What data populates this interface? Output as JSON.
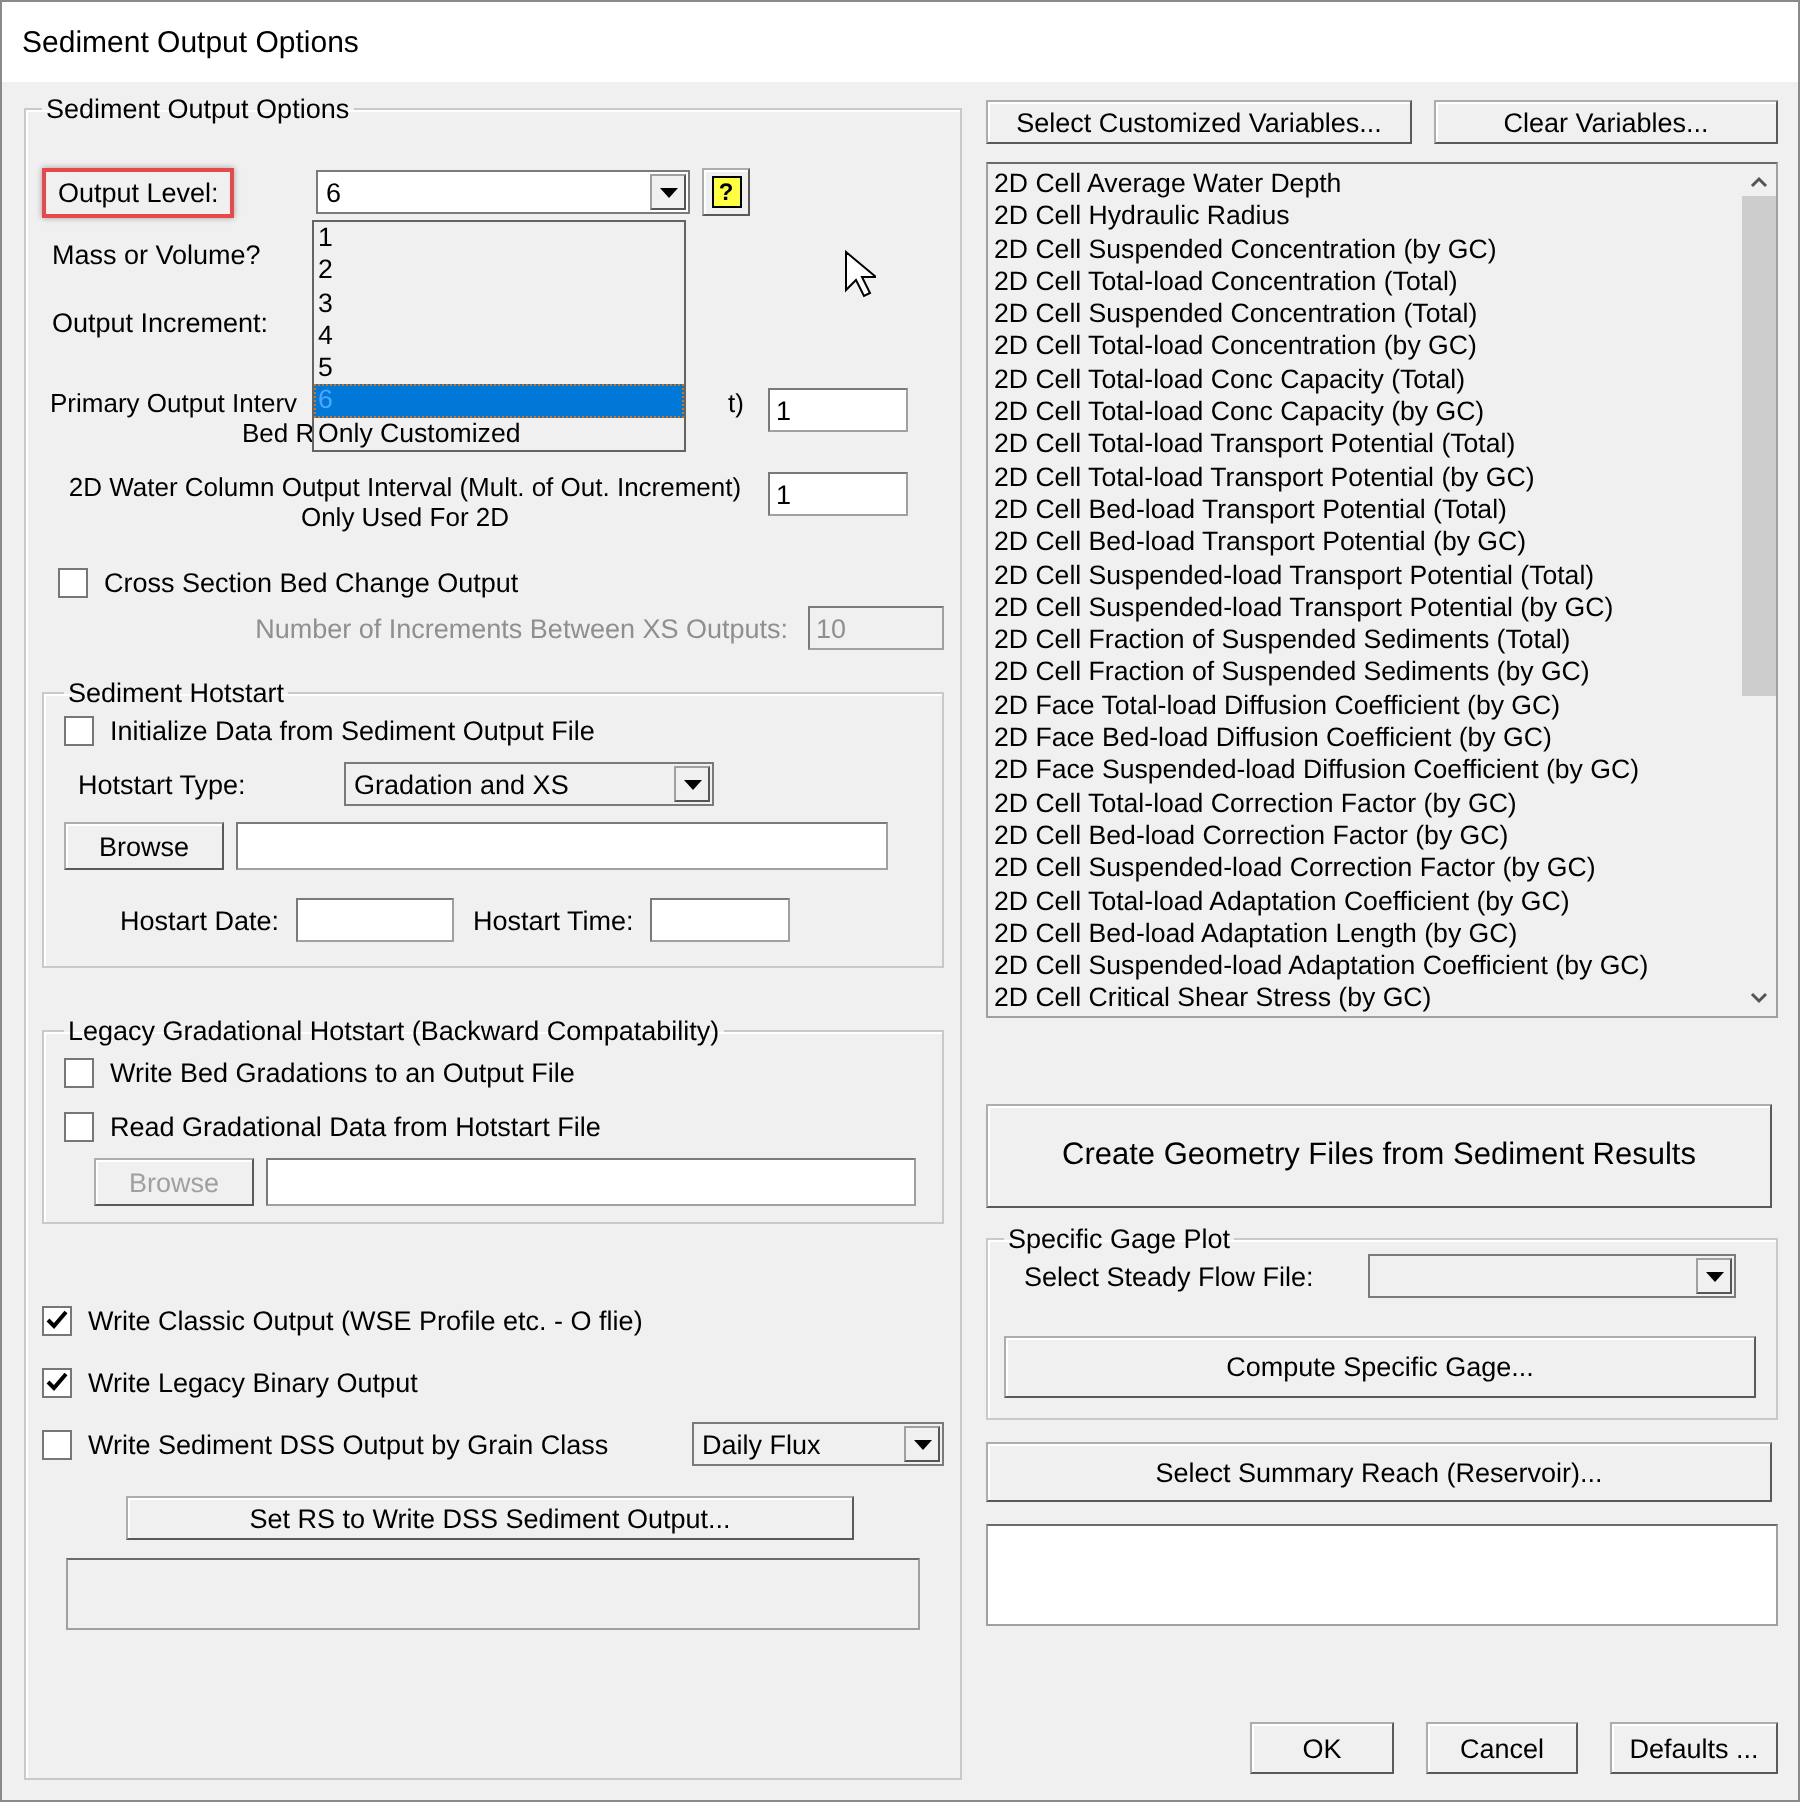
{
  "window": {
    "title": "Sediment Output Options"
  },
  "output_options": {
    "legend": "Sediment Output Options",
    "output_level": {
      "label": "Output Level:",
      "highlighted": true,
      "value": "6",
      "help_button": "?",
      "expanded": true,
      "options": [
        {
          "label": "1",
          "selected": false
        },
        {
          "label": "2",
          "selected": false
        },
        {
          "label": "3",
          "selected": false
        },
        {
          "label": "4",
          "selected": false
        },
        {
          "label": "5",
          "selected": false
        },
        {
          "label": "6",
          "selected": true
        },
        {
          "label": "Only Customized",
          "selected": false
        }
      ]
    },
    "mass_or_volume": {
      "label": "Mass or Volume?"
    },
    "output_increment": {
      "label": "Output Increment:"
    },
    "primary_interval": {
      "label_start": "Primary Output Interv",
      "label_end": "t)",
      "label_second_line": "Bed R",
      "value": "1"
    },
    "water_column_interval": {
      "label": "2D Water Column Output Interval (Mult. of Out. Increment)",
      "note": "Only Used For 2D",
      "value": "1"
    },
    "cross_section": {
      "label": "Cross Section Bed Change Output",
      "checked": false
    },
    "xs_increments": {
      "label": "Number of Increments Between XS Outputs:",
      "value": "10",
      "disabled": true
    },
    "hotstart": {
      "legend": "Sediment Hotstart",
      "initialize": {
        "label": "Initialize Data from Sediment Output File",
        "checked": false
      },
      "type_label": "Hotstart Type:",
      "type_value": "Gradation and XS",
      "browse": {
        "label": "Browse",
        "disabled": false
      },
      "date_label": "Hostart Date:",
      "time_label": "Hostart Time:"
    },
    "legacy": {
      "legend": "Legacy Gradational Hotstart (Backward Compatability)",
      "checkboxes": [
        {
          "label": "Write Bed Gradations to an Output File",
          "checked": false
        },
        {
          "label": "Read Gradational Data from Hotstart File",
          "checked": false
        }
      ],
      "browse": {
        "label": "Browse",
        "disabled": true
      }
    },
    "outputs": [
      {
        "label": "Write Classic Output (WSE Profile etc. - O flie)",
        "checked": true
      },
      {
        "label": "Write Legacy Binary Output",
        "checked": true
      },
      {
        "label": "Write Sediment DSS Output by Grain Class",
        "checked": false
      }
    ],
    "dss_type": "Daily Flux",
    "set_rs_button": "Set RS to Write DSS Sediment Output..."
  },
  "variables": {
    "buttons": [
      "Select Customized Variables...",
      "Clear Variables..."
    ],
    "items": [
      "2D Cell Average Water Depth",
      "2D Cell Hydraulic Radius",
      "2D Cell Suspended Concentration (by GC)",
      "2D Cell Total-load Concentration (Total)",
      "2D Cell Suspended Concentration (Total)",
      "2D Cell Total-load Concentration (by GC)",
      "2D Cell Total-load Conc Capacity (Total)",
      "2D Cell Total-load Conc Capacity (by GC)",
      "2D Cell Total-load Transport Potential (Total)",
      "2D Cell Total-load Transport Potential (by GC)",
      "2D Cell Bed-load Transport Potential (Total)",
      "2D Cell Bed-load Transport Potential (by GC)",
      "2D Cell Suspended-load Transport Potential (Total)",
      "2D Cell Suspended-load Transport Potential (by GC)",
      "2D Cell Fraction of Suspended Sediments (Total)",
      "2D Cell Fraction of Suspended Sediments (by GC)",
      "2D Face Total-load Diffusion Coefficient (by GC)",
      "2D Face Bed-load Diffusion Coefficient (by GC)",
      "2D Face Suspended-load Diffusion Coefficient (by GC)",
      "2D Cell Total-load Correction Factor (by GC)",
      "2D Cell Bed-load Correction Factor (by GC)",
      "2D Cell Suspended-load Correction Factor (by GC)",
      "2D Cell Total-load Adaptation Coefficient (by GC)",
      "2D Cell Bed-load Adaptation Length (by GC)",
      "2D Cell Suspended-load Adaptation Coefficient (by GC)",
      "2D Cell Critical Shear Stress (by GC)"
    ]
  },
  "create_geometry_button": "Create Geometry Files from Sediment Results",
  "specific_gage": {
    "legend": "Specific Gage Plot",
    "steady_flow_label": "Select Steady Flow File:",
    "compute_button": "Compute Specific Gage..."
  },
  "summary_reach_button": "Select Summary Reach (Reservoir)...",
  "dialog_buttons": [
    "OK",
    "Cancel",
    "Defaults ..."
  ]
}
